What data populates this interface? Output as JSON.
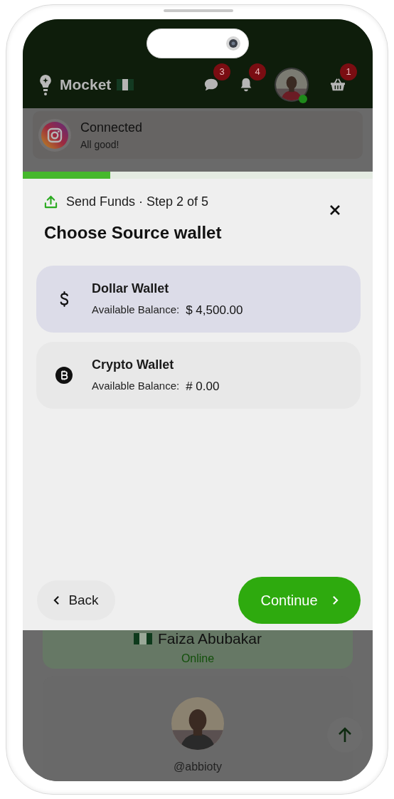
{
  "header": {
    "brand": "Mocket",
    "messages_badge": "3",
    "notifications_badge": "4",
    "avatar": {
      "kind": "picture",
      "online": true
    },
    "cart_badge": "1"
  },
  "toast": {
    "title": "Connected",
    "message": "All good!"
  },
  "background": {
    "profile_name": "Faiza Abubakar",
    "profile_status": "Online",
    "second_handle": "@abbioty"
  },
  "modal": {
    "progress": {
      "level": 0.25
    },
    "flow": "Send Funds",
    "separator": "·",
    "step": "Step 2 of 5",
    "title": "Choose Source wallet",
    "wallets": [
      {
        "kind": "dollar",
        "name": "Dollar Wallet",
        "balance_label": "Available Balance:",
        "balance": "$ 4,500.00",
        "selected": true
      },
      {
        "kind": "crypto",
        "name": "Crypto Wallet",
        "balance_label": "Available Balance:",
        "balance": "# 0.00",
        "selected": false
      }
    ],
    "back": "Back",
    "continue": "Continue"
  }
}
